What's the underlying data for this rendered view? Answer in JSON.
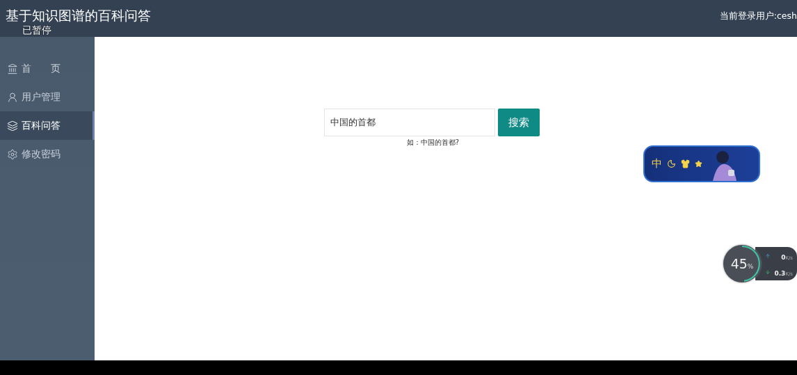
{
  "header": {
    "title": "基于知识图谱的百科问答",
    "status": "已暂停",
    "user": "当前登录用户:cesh"
  },
  "sidebar": {
    "items": [
      {
        "label": "首　　页",
        "selected": false
      },
      {
        "label": "用户管理",
        "selected": false
      },
      {
        "label": "百科问答",
        "selected": true
      },
      {
        "label": "修改密码",
        "selected": false
      }
    ]
  },
  "search": {
    "value": "中国的首都",
    "button": "搜索",
    "hint": "如：中国的首都?"
  },
  "ime_toolbar": {
    "mode": "中"
  },
  "net_meter": {
    "usage": "45",
    "unit": "%",
    "upload": "0",
    "upload_unit": "K/s",
    "download": "0.3",
    "download_unit": "K/s"
  }
}
